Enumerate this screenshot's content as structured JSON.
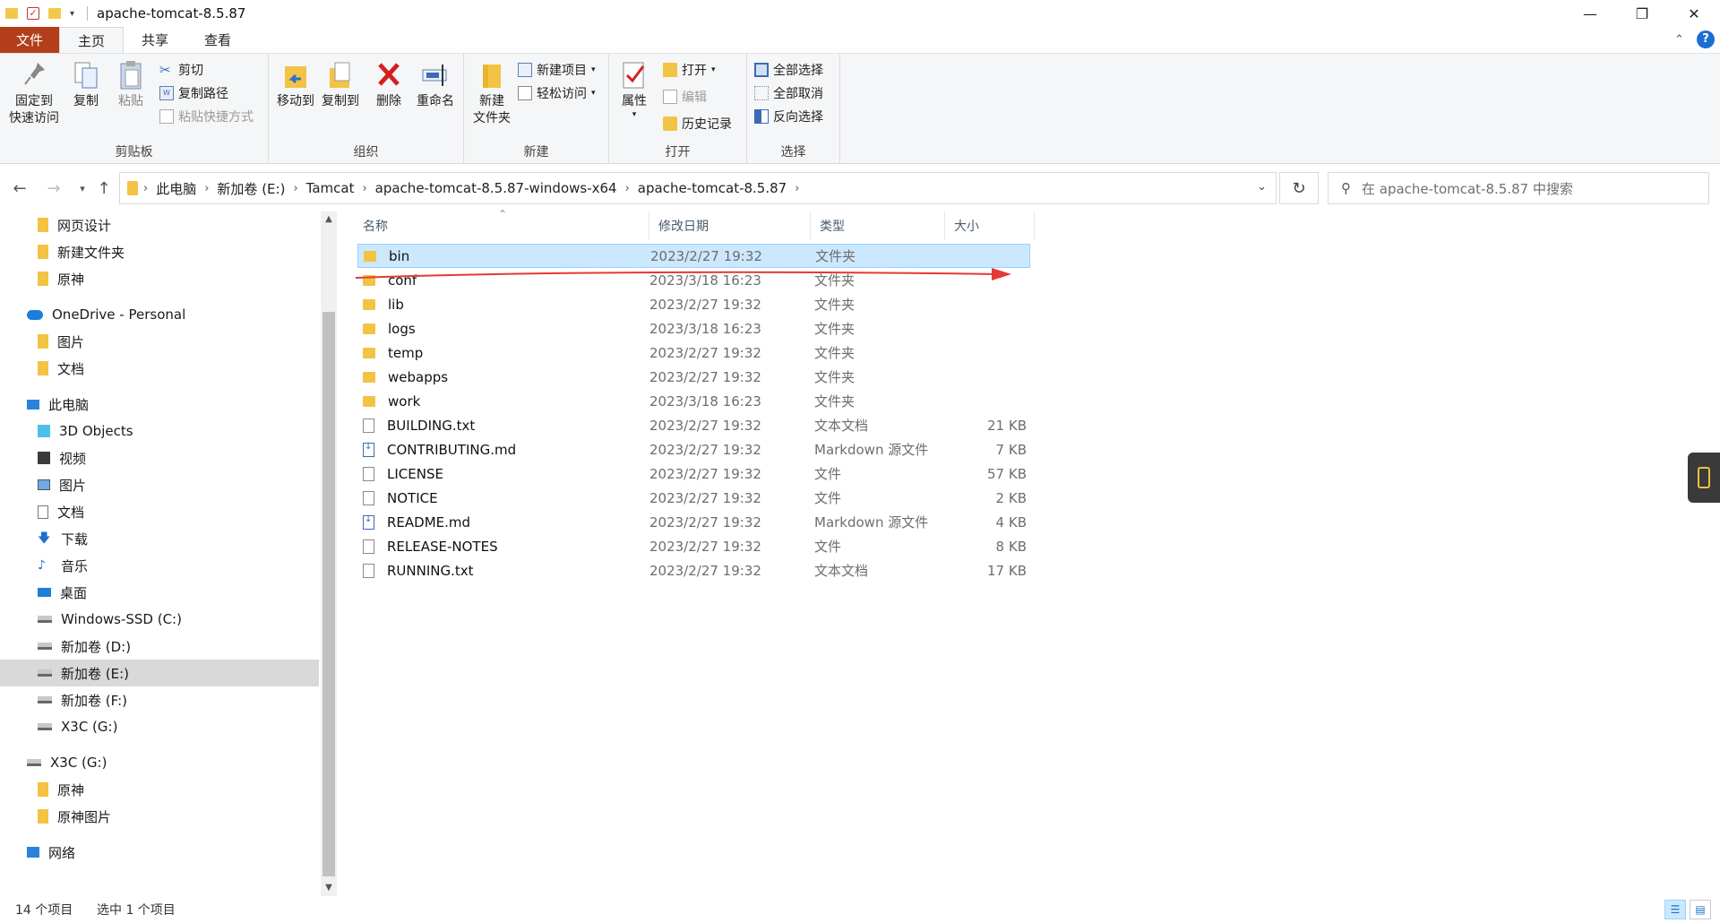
{
  "window": {
    "title": "apache-tomcat-8.5.87",
    "minimize": "—",
    "restore": "❐",
    "close": "✕"
  },
  "tabs": [
    {
      "label": "文件"
    },
    {
      "label": "主页"
    },
    {
      "label": "共享"
    },
    {
      "label": "查看"
    }
  ],
  "ribbon": {
    "clipboard": {
      "label": "剪贴板",
      "pin": "固定到\n快速访问",
      "pin_1": "固定到",
      "pin_2": "快速访问",
      "copy": "复制",
      "paste": "粘贴",
      "cut": "剪切",
      "copy_path": "复制路径",
      "paste_shortcut": "粘贴快捷方式"
    },
    "organize": {
      "label": "组织",
      "move_to": "移动到",
      "copy_to": "复制到",
      "delete": "删除",
      "rename": "重命名"
    },
    "new": {
      "label": "新建",
      "new_folder_1": "新建",
      "new_folder_2": "文件夹",
      "new_item": "新建项目",
      "easy_access": "轻松访问"
    },
    "open": {
      "label": "打开",
      "properties": "属性",
      "open": "打开",
      "edit": "编辑",
      "history": "历史记录"
    },
    "select": {
      "label": "选择",
      "select_all": "全部选择",
      "select_none": "全部取消",
      "invert": "反向选择"
    }
  },
  "address": {
    "crumbs": [
      "此电脑",
      "新加卷 (E:)",
      "Tamcat",
      "apache-tomcat-8.5.87-windows-x64",
      "apache-tomcat-8.5.87"
    ],
    "search_placeholder": "在 apache-tomcat-8.5.87 中搜索"
  },
  "nav": {
    "items": [
      {
        "label": "网页设计",
        "icon": "folder-icon",
        "selected": false
      },
      {
        "label": "新建文件夹",
        "icon": "folder-icon",
        "selected": false
      },
      {
        "label": "原神",
        "icon": "folder-icon",
        "selected": false
      },
      {
        "label": "OneDrive - Personal",
        "icon": "cloud-icon",
        "selected": false
      },
      {
        "label": "图片",
        "icon": "folder-icon",
        "selected": false
      },
      {
        "label": "文档",
        "icon": "folder-icon",
        "selected": false
      },
      {
        "label": "此电脑",
        "icon": "computer-icon",
        "selected": false
      },
      {
        "label": "3D Objects",
        "icon": "cube-icon",
        "selected": false
      },
      {
        "label": "视频",
        "icon": "video-icon",
        "selected": false
      },
      {
        "label": "图片",
        "icon": "pictures-icon",
        "selected": false
      },
      {
        "label": "文档",
        "icon": "documents-icon",
        "selected": false
      },
      {
        "label": "下载",
        "icon": "download-icon",
        "selected": false
      },
      {
        "label": "音乐",
        "icon": "music-icon",
        "selected": false
      },
      {
        "label": "桌面",
        "icon": "desktop-icon",
        "selected": false
      },
      {
        "label": "Windows-SSD (C:)",
        "icon": "drive-icon",
        "selected": false
      },
      {
        "label": "新加卷 (D:)",
        "icon": "drive-icon",
        "selected": false
      },
      {
        "label": "新加卷 (E:)",
        "icon": "drive-icon",
        "selected": true
      },
      {
        "label": "新加卷 (F:)",
        "icon": "drive-icon",
        "selected": false
      },
      {
        "label": "X3C (G:)",
        "icon": "drive-icon",
        "selected": false
      },
      {
        "label": "X3C (G:)",
        "icon": "drive-icon",
        "selected": false
      },
      {
        "label": "原神",
        "icon": "folder-icon",
        "selected": false
      },
      {
        "label": "原神图片",
        "icon": "folder-icon",
        "selected": false
      },
      {
        "label": "网络",
        "icon": "network-icon",
        "selected": false
      }
    ]
  },
  "columns": {
    "name": "名称",
    "date": "修改日期",
    "type": "类型",
    "size": "大小"
  },
  "files": [
    {
      "name": "bin",
      "date": "2023/2/27 19:32",
      "type": "文件夹",
      "size": "",
      "icon": "folder-icon",
      "selected": true
    },
    {
      "name": "conf",
      "date": "2023/3/18 16:23",
      "type": "文件夹",
      "size": "",
      "icon": "folder-icon",
      "selected": false
    },
    {
      "name": "lib",
      "date": "2023/2/27 19:32",
      "type": "文件夹",
      "size": "",
      "icon": "folder-icon",
      "selected": false
    },
    {
      "name": "logs",
      "date": "2023/3/18 16:23",
      "type": "文件夹",
      "size": "",
      "icon": "folder-icon",
      "selected": false
    },
    {
      "name": "temp",
      "date": "2023/2/27 19:32",
      "type": "文件夹",
      "size": "",
      "icon": "folder-icon",
      "selected": false
    },
    {
      "name": "webapps",
      "date": "2023/2/27 19:32",
      "type": "文件夹",
      "size": "",
      "icon": "folder-icon",
      "selected": false
    },
    {
      "name": "work",
      "date": "2023/3/18 16:23",
      "type": "文件夹",
      "size": "",
      "icon": "folder-icon",
      "selected": false
    },
    {
      "name": "BUILDING.txt",
      "date": "2023/2/27 19:32",
      "type": "文本文档",
      "size": "21 KB",
      "icon": "text-file-icon",
      "selected": false
    },
    {
      "name": "CONTRIBUTING.md",
      "date": "2023/2/27 19:32",
      "type": "Markdown 源文件",
      "size": "7 KB",
      "icon": "markdown-file-icon",
      "selected": false
    },
    {
      "name": "LICENSE",
      "date": "2023/2/27 19:32",
      "type": "文件",
      "size": "57 KB",
      "icon": "file-icon",
      "selected": false
    },
    {
      "name": "NOTICE",
      "date": "2023/2/27 19:32",
      "type": "文件",
      "size": "2 KB",
      "icon": "file-icon",
      "selected": false
    },
    {
      "name": "README.md",
      "date": "2023/2/27 19:32",
      "type": "Markdown 源文件",
      "size": "4 KB",
      "icon": "markdown-file-icon",
      "selected": false
    },
    {
      "name": "RELEASE-NOTES",
      "date": "2023/2/27 19:32",
      "type": "文件",
      "size": "8 KB",
      "icon": "file-icon",
      "selected": false
    },
    {
      "name": "RUNNING.txt",
      "date": "2023/2/27 19:32",
      "type": "文本文档",
      "size": "17 KB",
      "icon": "text-file-icon",
      "selected": false
    }
  ],
  "status": {
    "count": "14 个项目",
    "selected": "选中 1 个项目"
  },
  "colors": {
    "file_tab": "#b33f1a",
    "selection": "#cce8ff",
    "annotation_arrow": "#e53935"
  }
}
